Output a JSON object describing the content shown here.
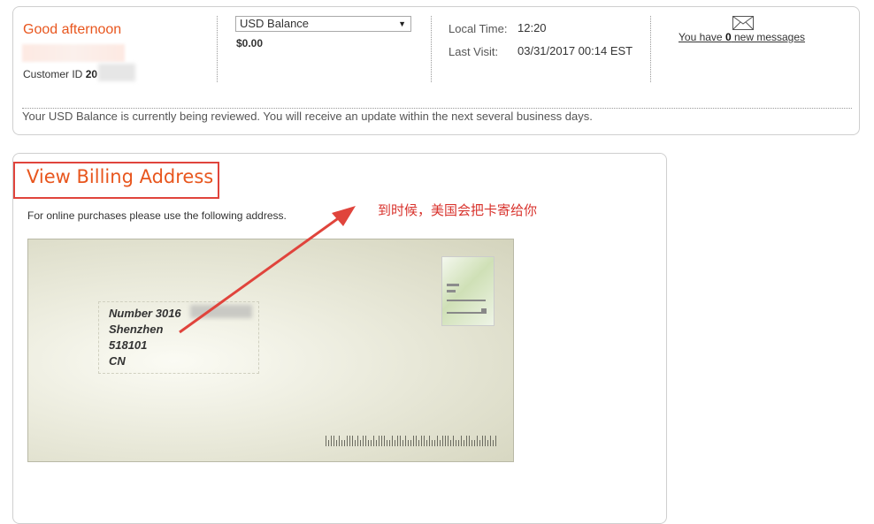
{
  "header": {
    "greeting": "Good afternoon",
    "customer_id_label": "Customer ID",
    "customer_id_value": "20",
    "balance_select": "USD Balance",
    "balance_amount": "$0.00",
    "local_time_label": "Local Time:",
    "local_time_value": "12:20",
    "last_visit_label": "Last Visit:",
    "last_visit_value": "03/31/2017 00:14 EST",
    "messages_prefix": "You have ",
    "messages_count": "0",
    "messages_suffix": " new messages",
    "notice": "Your USD Balance is currently being reviewed. You will receive an update within the next several business days."
  },
  "billing": {
    "title": "View Billing Address",
    "instruction": "For online purchases please use the following address.",
    "address_lines": [
      "Number 3016",
      "Shenzhen",
      "518101",
      "CN"
    ]
  },
  "annotation": {
    "text": "到时候，美国会把卡寄给你",
    "color": "#d8322c"
  },
  "colors": {
    "accent": "#e8561e",
    "highlight_border": "#e0443c"
  },
  "icons": {
    "mail": "envelope-icon",
    "select_arrow": "caret-down-icon"
  }
}
